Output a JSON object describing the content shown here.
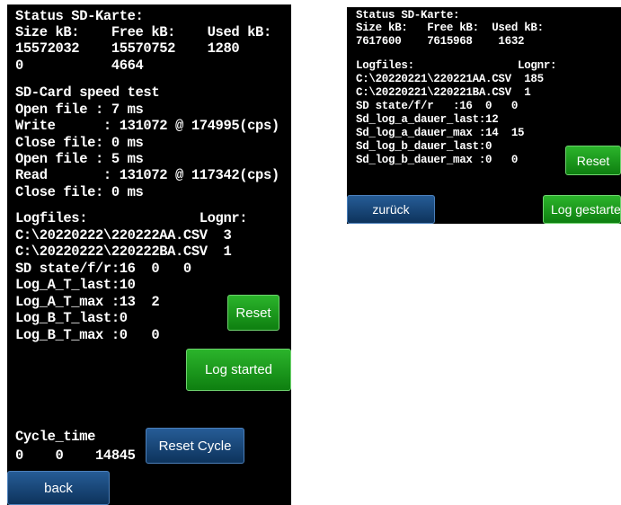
{
  "left": {
    "status_title": "Status SD-Karte:",
    "status_header": "Size kB:    Free kB:    Used kB:",
    "status_values": "15572032    15570752    1280",
    "status_values2": "0           4664",
    "speed_title": "SD-Card speed test",
    "open_file_1": "Open file : 7 ms",
    "write_line": "Write      : 131072 @ 174995(cps)",
    "close_file_1": "Close file: 0 ms",
    "open_file_2": "Open file : 5 ms",
    "read_line": "Read       : 131072 @ 117342(cps)",
    "close_file_2": "Close file: 0 ms",
    "logfiles_header": "Logfiles:              Lognr:",
    "logfile_1": "C:\\20220222\\220222AA.CSV  3",
    "logfile_2": "C:\\20220222\\220222BA.CSV  1",
    "sd_state": "SD state/f/r:16  0   0",
    "log_a_last": "Log_A_T_last:10",
    "log_a_max": "Log_A_T_max :13  2",
    "log_b_last": "Log_B_T_last:0",
    "log_b_max": "Log_B_T_max :0   0",
    "cycle_title": "Cycle_time",
    "cycle_values": "0    0    14845",
    "reset_label": "Reset",
    "log_started_label": "Log started",
    "reset_cycle_label": "Reset Cycle",
    "back_label": "back"
  },
  "right": {
    "status_title": "Status SD-Karte:",
    "status_header": "Size kB:   Free kB:  Used kB:",
    "status_values": "7617600    7615968    1632",
    "logfiles_header": "Logfiles:                Lognr:",
    "logfile_1": "C:\\20220221\\220221AA.CSV  185",
    "logfile_2": "C:\\20220221\\220221BA.CSV  1",
    "sd_state": "SD state/f/r   :16  0   0",
    "a_last": "Sd_log_a_dauer_last:12",
    "a_max": "Sd_log_a_dauer_max :14  15",
    "b_last": "Sd_log_b_dauer_last:0",
    "b_max": "Sd_log_b_dauer_max :0   0",
    "reset_label": "Reset",
    "back_label": "zurück",
    "log_label": "Log gestartet"
  }
}
